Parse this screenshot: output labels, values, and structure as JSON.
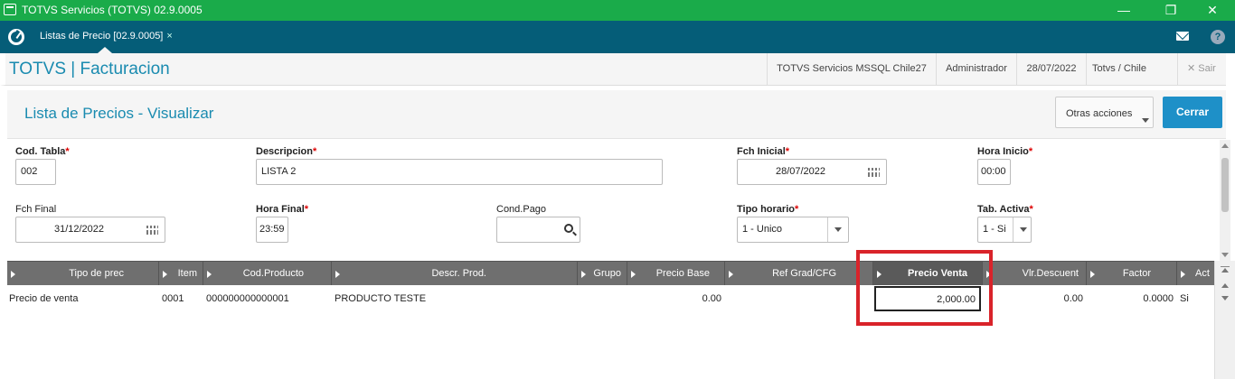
{
  "window": {
    "title": "TOTVS Servicios (TOTVS) 02.9.0005",
    "controls": [
      "—",
      "❐",
      "✕"
    ]
  },
  "tabbar": {
    "tab_label": "Listas de Precio [02.9.0005]",
    "tab_close": "×",
    "help": "?"
  },
  "header": {
    "brand": "TOTVS | Facturacion",
    "environment": "TOTVS Servicios MSSQL Chile27",
    "user": "Administrador",
    "date": "28/07/2022",
    "company": "Totvs / Chile",
    "exit_label": "Sair",
    "exit_icon": "✕"
  },
  "page": {
    "title": "Lista de Precios - Visualizar",
    "other_actions": "Otras acciones",
    "close": "Cerrar"
  },
  "form": {
    "cod_tabla": {
      "label": "Cod. Tabla",
      "required": "*",
      "value": "002"
    },
    "descripcion": {
      "label": "Descripcion",
      "required": "*",
      "value": "LISTA 2"
    },
    "fch_inicial": {
      "label": "Fch Inicial",
      "required": "*",
      "value": "28/07/2022"
    },
    "hora_inicio": {
      "label": "Hora Inicio",
      "required": "*",
      "value": "00:00"
    },
    "fch_final": {
      "label": "Fch Final",
      "value": "31/12/2022"
    },
    "hora_final": {
      "label": "Hora Final",
      "required": "*",
      "value": "23:59"
    },
    "cond_pago": {
      "label": "Cond.Pago",
      "value": ""
    },
    "tipo_horario": {
      "label": "Tipo horario",
      "required": "*",
      "value": "1 - Unico"
    },
    "tab_activa": {
      "label": "Tab. Activa",
      "required": "*",
      "value": "1 - Si"
    }
  },
  "grid": {
    "columns": [
      "Tipo de prec",
      "Item",
      "Cod.Producto",
      "Descr. Prod.",
      "Grupo",
      "Precio Base",
      "Ref Grad/CFG",
      "Precio Venta",
      "Vlr.Descuent",
      "Factor",
      "Act"
    ],
    "rows": [
      [
        "Precio de venta",
        "0001",
        "000000000000001",
        "PRODUCTO TESTE",
        "",
        "0.00",
        "",
        "2,000.00",
        "0.00",
        "0.0000",
        "Si"
      ]
    ]
  },
  "colors": {
    "titlebar": "#1aab4a",
    "tabbar": "#055d78",
    "brand": "#1a8bb0",
    "primary_button": "#1e90c8",
    "highlight": "#d9232a"
  }
}
